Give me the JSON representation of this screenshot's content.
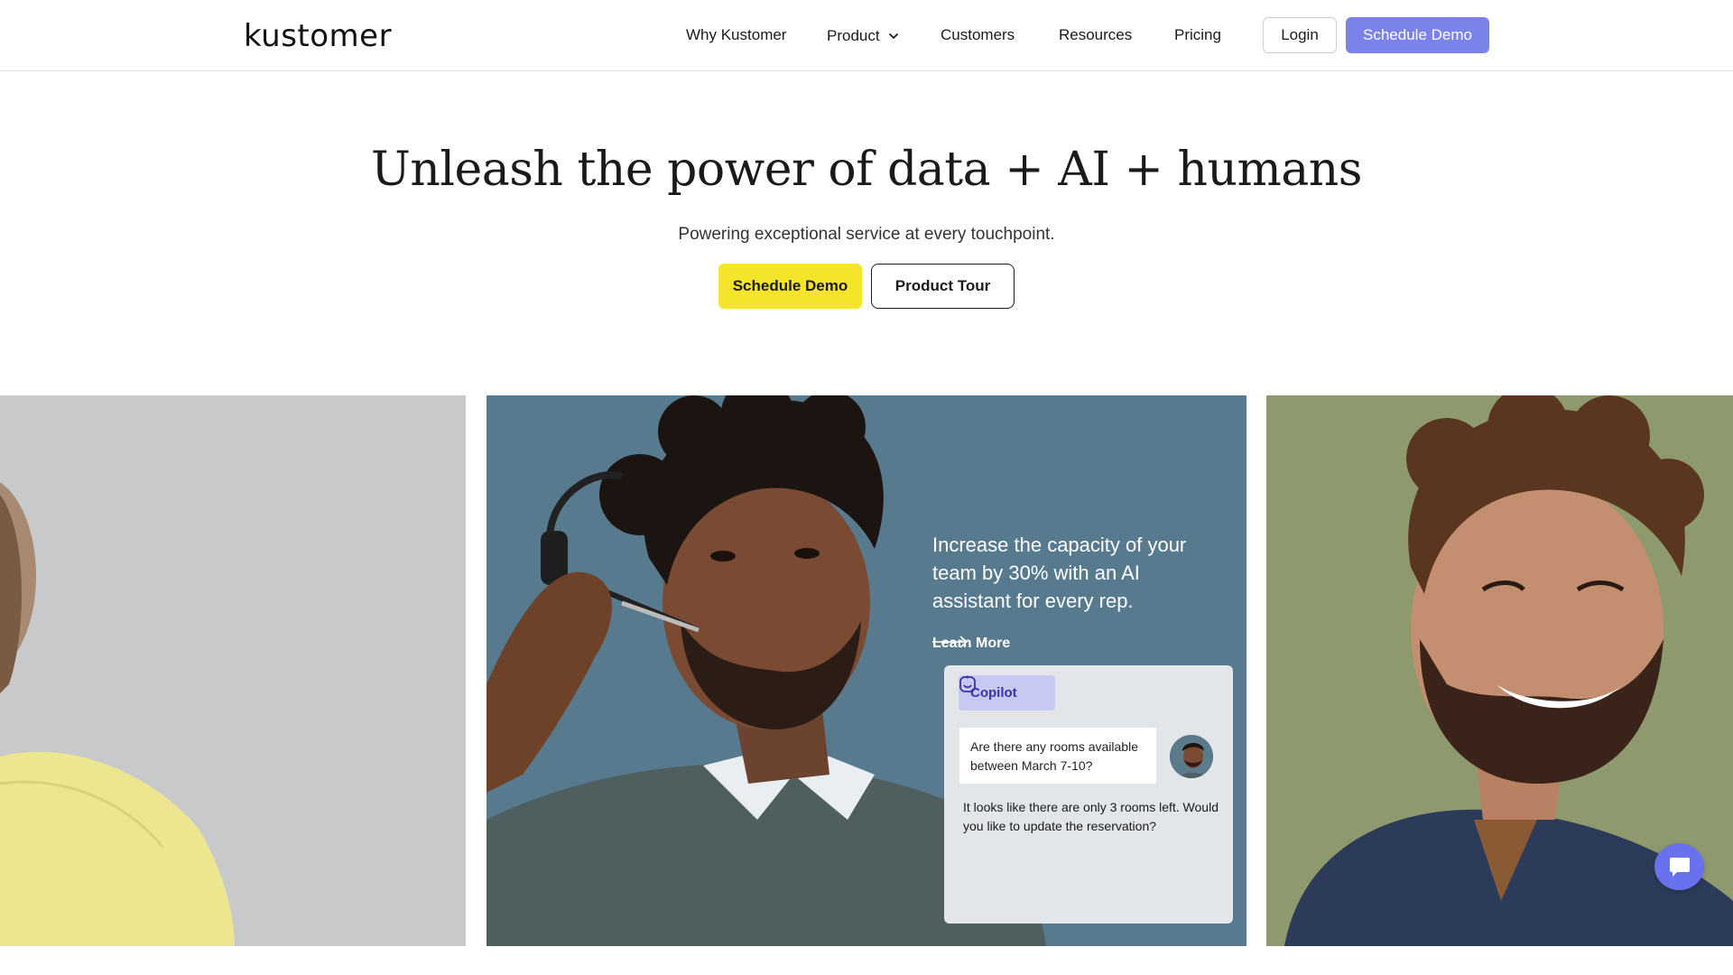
{
  "brand": {
    "logo_text": "kustomer",
    "accent_color": "#7b83eb",
    "cta_yellow": "#f5e52a"
  },
  "nav": {
    "items": [
      {
        "label": "Why Kustomer"
      },
      {
        "label": "Product"
      },
      {
        "label": "Customers"
      },
      {
        "label": "Resources"
      },
      {
        "label": "Pricing"
      }
    ],
    "login_label": "Login",
    "demo_label": "Schedule Demo"
  },
  "hero": {
    "title": "Unleash the power of data + AI + humans",
    "subtitle": "Powering exceptional service at every touchpoint.",
    "primary_cta": "Schedule Demo",
    "secondary_cta": "Product Tour"
  },
  "feature_card": {
    "headline": "Increase the capacity of your team by 30% with an AI assistant for every rep.",
    "link_label": "Learn More",
    "copilot": {
      "badge": "Copilot",
      "question": "Are there any rooms available between March 7-10?",
      "answer": "It looks like there are only 3 rooms left. Would you like to update the reservation?"
    }
  },
  "icons": [
    "chevron-down-icon",
    "arrow-right-icon",
    "copilot-icon",
    "chat-icon"
  ]
}
